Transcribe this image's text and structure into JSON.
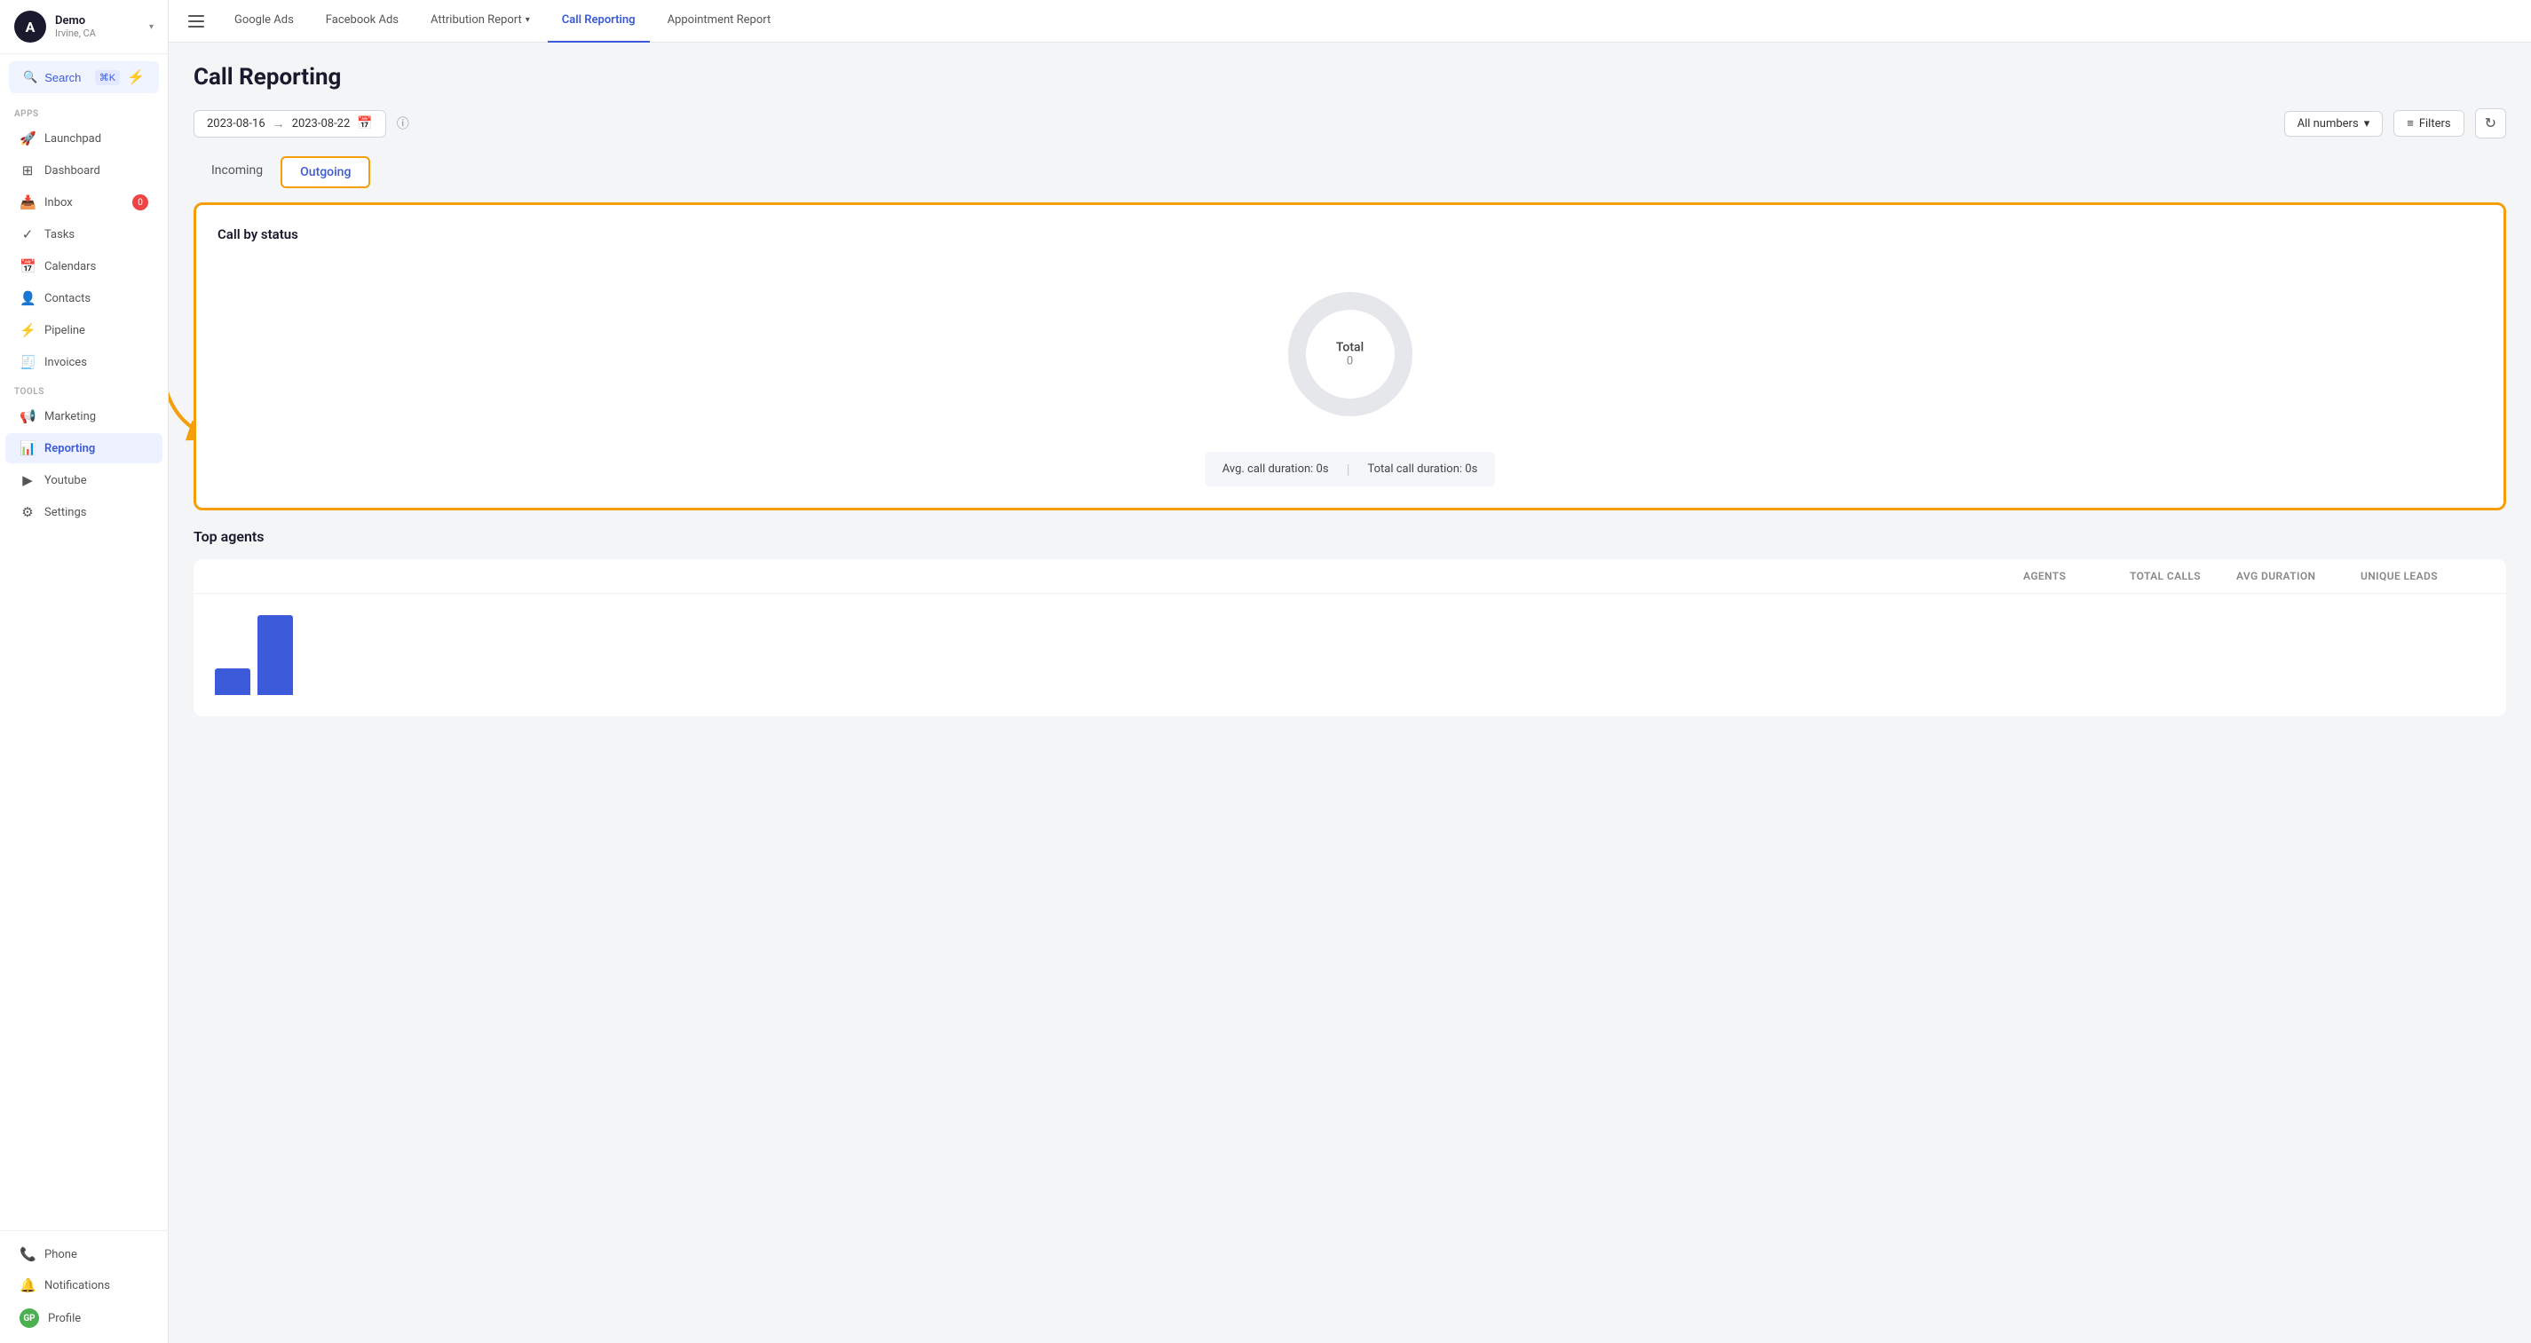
{
  "sidebar": {
    "logo": {
      "initial": "A",
      "user_name": "Demo",
      "user_location": "Irvine, CA"
    },
    "search": {
      "label": "Search",
      "shortcut": "⌘K"
    },
    "apps_label": "Apps",
    "tools_label": "Tools",
    "nav_items": [
      {
        "id": "launchpad",
        "label": "Launchpad",
        "icon": "🚀"
      },
      {
        "id": "dashboard",
        "label": "Dashboard",
        "icon": "⊞"
      },
      {
        "id": "inbox",
        "label": "Inbox",
        "icon": "📥",
        "badge": "0"
      },
      {
        "id": "tasks",
        "label": "Tasks",
        "icon": "✓"
      },
      {
        "id": "calendars",
        "label": "Calendars",
        "icon": "📅"
      },
      {
        "id": "contacts",
        "label": "Contacts",
        "icon": "👤"
      },
      {
        "id": "pipeline",
        "label": "Pipeline",
        "icon": "⚡"
      },
      {
        "id": "invoices",
        "label": "Invoices",
        "icon": "🧾"
      }
    ],
    "tools_items": [
      {
        "id": "marketing",
        "label": "Marketing",
        "icon": "📢"
      },
      {
        "id": "reporting",
        "label": "Reporting",
        "icon": "📊",
        "active": true
      },
      {
        "id": "youtube",
        "label": "Youtube",
        "icon": "▶"
      },
      {
        "id": "settings",
        "label": "Settings",
        "icon": "⚙"
      }
    ],
    "bottom_items": [
      {
        "id": "phone",
        "label": "Phone",
        "icon": "📞"
      },
      {
        "id": "notifications",
        "label": "Notifications",
        "icon": "🔔"
      },
      {
        "id": "profile",
        "label": "Profile",
        "icon": "GP",
        "is_avatar": true
      }
    ]
  },
  "top_nav": {
    "tabs": [
      {
        "id": "google-ads",
        "label": "Google Ads",
        "active": false
      },
      {
        "id": "facebook-ads",
        "label": "Facebook Ads",
        "active": false
      },
      {
        "id": "attribution-report",
        "label": "Attribution Report",
        "active": false,
        "has_dropdown": true
      },
      {
        "id": "call-reporting",
        "label": "Call Reporting",
        "active": true
      },
      {
        "id": "appointment-report",
        "label": "Appointment Report",
        "active": false
      }
    ]
  },
  "page": {
    "title": "Call Reporting",
    "date_from": "2023-08-16",
    "date_to": "2023-08-22",
    "all_numbers_label": "All numbers",
    "filters_label": "Filters",
    "tabs": [
      {
        "id": "incoming",
        "label": "Incoming",
        "active": false
      },
      {
        "id": "outgoing",
        "label": "Outgoing",
        "active": true
      }
    ],
    "call_by_status": {
      "title": "Call by status",
      "total_label": "Total",
      "total_value": "0",
      "avg_duration": "Avg. call duration: 0s",
      "total_duration": "Total call duration: 0s"
    },
    "top_agents": {
      "title": "Top agents",
      "columns": [
        "Agents",
        "Total calls",
        "Avg Duration",
        "Unique leads"
      ],
      "chart_bars": [
        30,
        90
      ]
    }
  }
}
